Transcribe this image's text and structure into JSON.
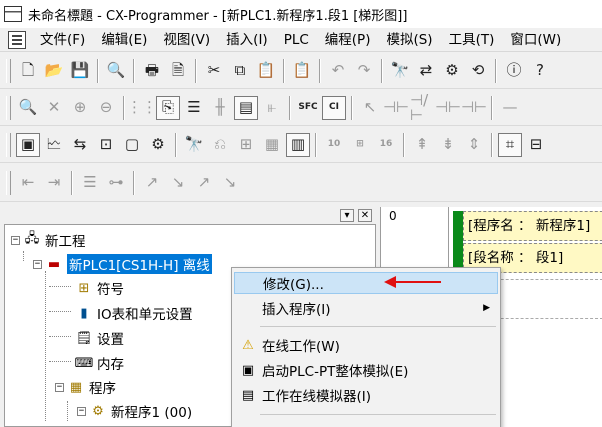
{
  "window": {
    "title": "未命名標題 - CX-Programmer - [新PLC1.新程序1.段1 [梯形图]]"
  },
  "menubar": {
    "items": [
      "文件(F)",
      "编辑(E)",
      "视图(V)",
      "插入(I)",
      "PLC",
      "编程(P)",
      "模拟(S)",
      "工具(T)",
      "窗口(W)"
    ]
  },
  "toolbar3": {
    "btn10": "10",
    "btn16": "16"
  },
  "tree": {
    "root": "新工程",
    "plc": "新PLC1[CS1H-H] 离线",
    "children": [
      "符号",
      "IO表和单元设置",
      "设置",
      "内存",
      "程序",
      "新程序1 (00)"
    ]
  },
  "ladder": {
    "rung_number": "0",
    "program_name": "[程序名 ： 新程序1]",
    "section_name": "[段名称 ： 段1]"
  },
  "context_menu": {
    "items": [
      "修改(G)...",
      "插入程序(I)",
      "在线工作(W)",
      "启动PLC-PT整体模拟(E)",
      "工作在线模拟器(I)"
    ]
  },
  "colors": {
    "selection": "#0078d7",
    "menu_highlight": "#cce4f7",
    "arrow": "#e01010",
    "rail": "#0a8a1a",
    "info_box": "#fff9c4"
  }
}
